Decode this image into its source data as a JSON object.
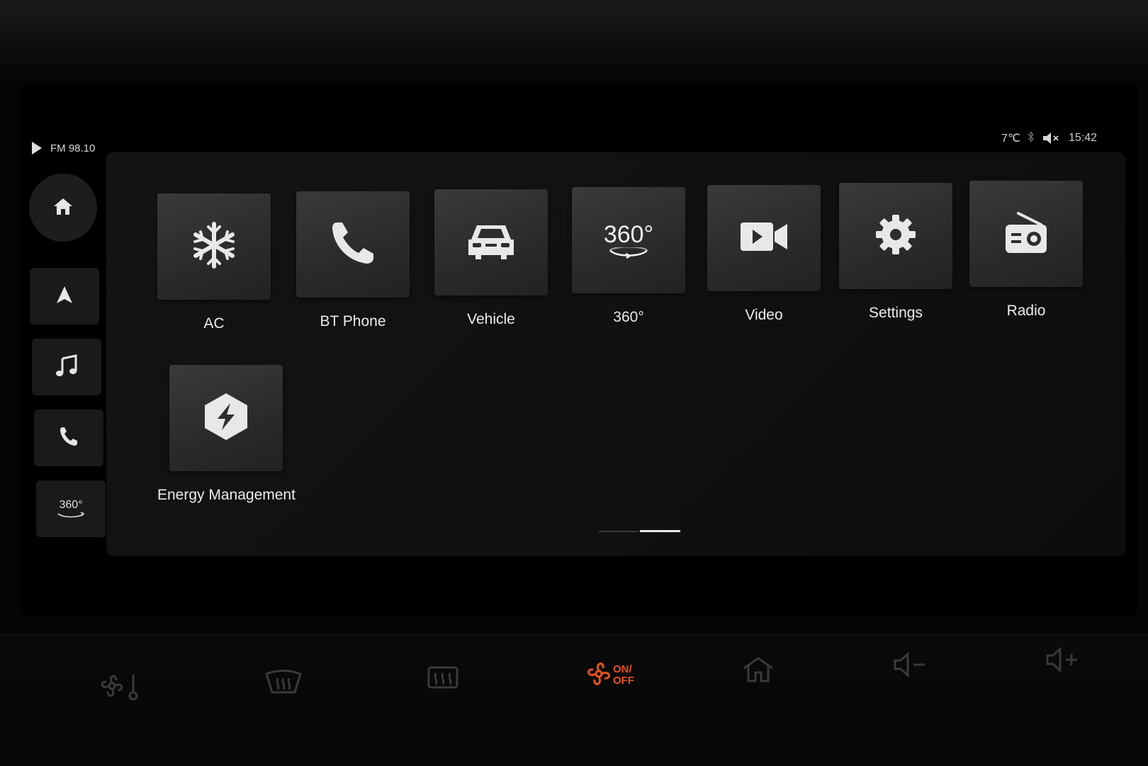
{
  "status": {
    "media": "FM 98.10",
    "temperature": "7℃",
    "time": "15:42",
    "icons": [
      "play-icon",
      "bluetooth-icon",
      "volume-muted-icon"
    ]
  },
  "sidebar": [
    {
      "name": "home",
      "icon": "home-icon"
    },
    {
      "name": "navigation",
      "icon": "navigation-arrow-icon"
    },
    {
      "name": "music",
      "icon": "music-note-icon"
    },
    {
      "name": "phone",
      "icon": "phone-icon"
    },
    {
      "name": "camera-360",
      "icon": "360-icon",
      "label": "360°"
    }
  ],
  "apps": [
    {
      "label": "AC",
      "icon": "snowflake-icon"
    },
    {
      "label": "BT Phone",
      "icon": "phone-icon"
    },
    {
      "label": "Vehicle",
      "icon": "car-icon"
    },
    {
      "label": "360°",
      "icon": "360-view-icon",
      "icon_text": "360°"
    },
    {
      "label": "Video",
      "icon": "video-camera-icon"
    },
    {
      "label": "Settings",
      "icon": "gear-icon"
    },
    {
      "label": "Radio",
      "icon": "radio-icon"
    },
    {
      "label": "Energy Management",
      "icon": "energy-hexagon-icon"
    }
  ],
  "pager": {
    "pages": 2,
    "current": 2
  },
  "hardware_buttons": [
    {
      "name": "fan-temperature",
      "icon": "fan-thermometer-icon"
    },
    {
      "name": "front-defrost",
      "icon": "front-defrost-icon"
    },
    {
      "name": "rear-defrost",
      "icon": "rear-defrost-icon"
    },
    {
      "name": "climate-on-off",
      "icon": "fan-icon",
      "text_on": "ON/",
      "text_off": "OFF",
      "color": "#e8531e"
    },
    {
      "name": "home",
      "icon": "home-outline-icon"
    },
    {
      "name": "volume-down",
      "icon": "volume-down-icon"
    },
    {
      "name": "volume-up",
      "icon": "volume-up-icon"
    }
  ],
  "colors": {
    "accent": "#e8531e",
    "tile": "#2e2e2e",
    "background": "#000000"
  }
}
